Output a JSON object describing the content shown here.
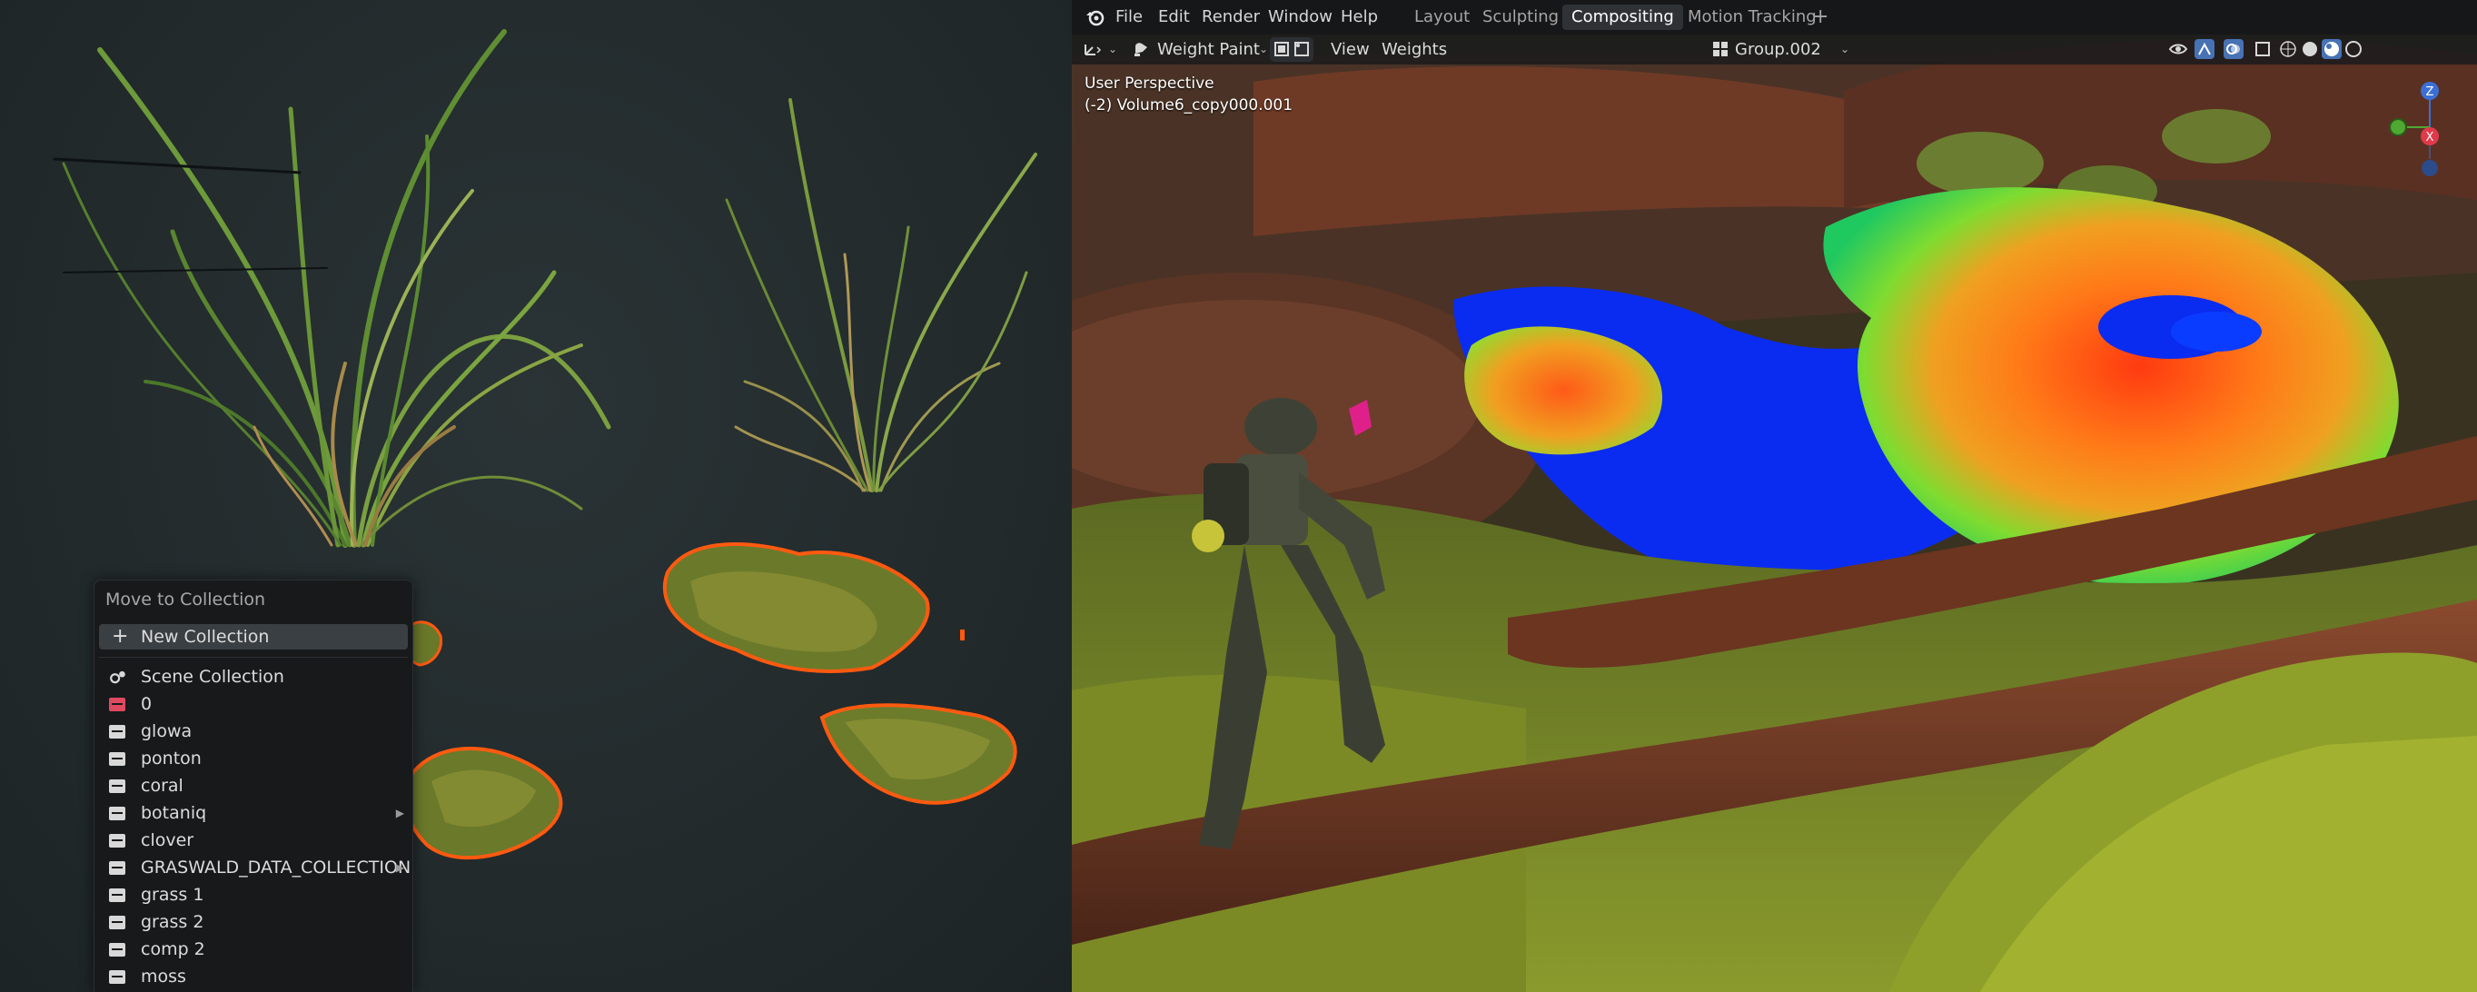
{
  "topbar": {
    "menus": [
      "File",
      "Edit",
      "Render",
      "Window",
      "Help"
    ],
    "workspaces": [
      "Layout",
      "Sculpting",
      "Compositing",
      "Motion Tracking"
    ],
    "active_workspace": "Compositing",
    "add_workspace": "+"
  },
  "header": {
    "mode": "Weight Paint",
    "view_menu": "View",
    "weights_menu": "Weights",
    "vertex_group": "Group.002"
  },
  "viewport_info": {
    "perspective": "User Perspective",
    "object": "(-2) Volume6_copy000.001"
  },
  "gizmo": {
    "z": "Z",
    "x": "X"
  },
  "collection_menu": {
    "title": "Move to Collection",
    "new_collection": "New Collection",
    "items": [
      {
        "label": "Scene Collection",
        "icon": "scene-collection-icon"
      },
      {
        "label": "0",
        "icon": "collection-icon-red"
      },
      {
        "label": "glowa",
        "icon": "collection-icon"
      },
      {
        "label": "ponton",
        "icon": "collection-icon"
      },
      {
        "label": "coral",
        "icon": "collection-icon"
      },
      {
        "label": "botaniq",
        "icon": "collection-icon",
        "submenu": true
      },
      {
        "label": "clover",
        "icon": "collection-icon"
      },
      {
        "label": "GRASWALD_DATA_COLLECTION",
        "icon": "collection-icon",
        "submenu": true
      },
      {
        "label": "grass 1",
        "icon": "collection-icon"
      },
      {
        "label": "grass 2",
        "icon": "collection-icon"
      },
      {
        "label": "comp 2",
        "icon": "collection-icon"
      },
      {
        "label": "moss",
        "icon": "collection-icon"
      }
    ]
  },
  "colors": {
    "accent_blue": "#4772b3",
    "collection_red": "#e04a5f",
    "selection_orange": "#ff6a1a"
  }
}
